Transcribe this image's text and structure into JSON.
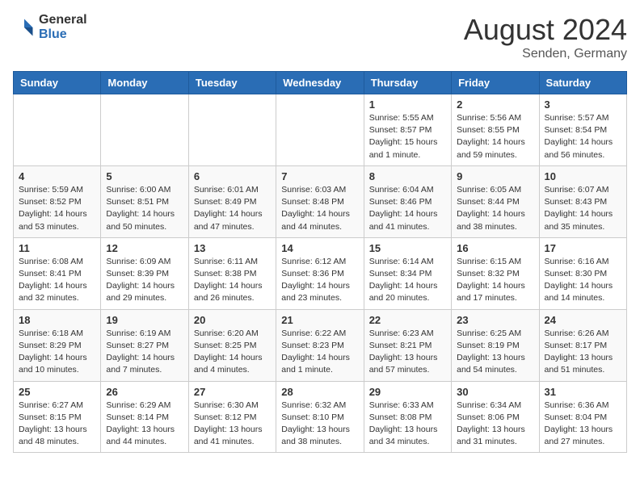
{
  "header": {
    "logo_general": "General",
    "logo_blue": "Blue",
    "month_year": "August 2024",
    "location": "Senden, Germany"
  },
  "calendar": {
    "days_of_week": [
      "Sunday",
      "Monday",
      "Tuesday",
      "Wednesday",
      "Thursday",
      "Friday",
      "Saturday"
    ],
    "weeks": [
      [
        {
          "day": "",
          "info": ""
        },
        {
          "day": "",
          "info": ""
        },
        {
          "day": "",
          "info": ""
        },
        {
          "day": "",
          "info": ""
        },
        {
          "day": "1",
          "info": "Sunrise: 5:55 AM\nSunset: 8:57 PM\nDaylight: 15 hours\nand 1 minute."
        },
        {
          "day": "2",
          "info": "Sunrise: 5:56 AM\nSunset: 8:55 PM\nDaylight: 14 hours\nand 59 minutes."
        },
        {
          "day": "3",
          "info": "Sunrise: 5:57 AM\nSunset: 8:54 PM\nDaylight: 14 hours\nand 56 minutes."
        }
      ],
      [
        {
          "day": "4",
          "info": "Sunrise: 5:59 AM\nSunset: 8:52 PM\nDaylight: 14 hours\nand 53 minutes."
        },
        {
          "day": "5",
          "info": "Sunrise: 6:00 AM\nSunset: 8:51 PM\nDaylight: 14 hours\nand 50 minutes."
        },
        {
          "day": "6",
          "info": "Sunrise: 6:01 AM\nSunset: 8:49 PM\nDaylight: 14 hours\nand 47 minutes."
        },
        {
          "day": "7",
          "info": "Sunrise: 6:03 AM\nSunset: 8:48 PM\nDaylight: 14 hours\nand 44 minutes."
        },
        {
          "day": "8",
          "info": "Sunrise: 6:04 AM\nSunset: 8:46 PM\nDaylight: 14 hours\nand 41 minutes."
        },
        {
          "day": "9",
          "info": "Sunrise: 6:05 AM\nSunset: 8:44 PM\nDaylight: 14 hours\nand 38 minutes."
        },
        {
          "day": "10",
          "info": "Sunrise: 6:07 AM\nSunset: 8:43 PM\nDaylight: 14 hours\nand 35 minutes."
        }
      ],
      [
        {
          "day": "11",
          "info": "Sunrise: 6:08 AM\nSunset: 8:41 PM\nDaylight: 14 hours\nand 32 minutes."
        },
        {
          "day": "12",
          "info": "Sunrise: 6:09 AM\nSunset: 8:39 PM\nDaylight: 14 hours\nand 29 minutes."
        },
        {
          "day": "13",
          "info": "Sunrise: 6:11 AM\nSunset: 8:38 PM\nDaylight: 14 hours\nand 26 minutes."
        },
        {
          "day": "14",
          "info": "Sunrise: 6:12 AM\nSunset: 8:36 PM\nDaylight: 14 hours\nand 23 minutes."
        },
        {
          "day": "15",
          "info": "Sunrise: 6:14 AM\nSunset: 8:34 PM\nDaylight: 14 hours\nand 20 minutes."
        },
        {
          "day": "16",
          "info": "Sunrise: 6:15 AM\nSunset: 8:32 PM\nDaylight: 14 hours\nand 17 minutes."
        },
        {
          "day": "17",
          "info": "Sunrise: 6:16 AM\nSunset: 8:30 PM\nDaylight: 14 hours\nand 14 minutes."
        }
      ],
      [
        {
          "day": "18",
          "info": "Sunrise: 6:18 AM\nSunset: 8:29 PM\nDaylight: 14 hours\nand 10 minutes."
        },
        {
          "day": "19",
          "info": "Sunrise: 6:19 AM\nSunset: 8:27 PM\nDaylight: 14 hours\nand 7 minutes."
        },
        {
          "day": "20",
          "info": "Sunrise: 6:20 AM\nSunset: 8:25 PM\nDaylight: 14 hours\nand 4 minutes."
        },
        {
          "day": "21",
          "info": "Sunrise: 6:22 AM\nSunset: 8:23 PM\nDaylight: 14 hours\nand 1 minute."
        },
        {
          "day": "22",
          "info": "Sunrise: 6:23 AM\nSunset: 8:21 PM\nDaylight: 13 hours\nand 57 minutes."
        },
        {
          "day": "23",
          "info": "Sunrise: 6:25 AM\nSunset: 8:19 PM\nDaylight: 13 hours\nand 54 minutes."
        },
        {
          "day": "24",
          "info": "Sunrise: 6:26 AM\nSunset: 8:17 PM\nDaylight: 13 hours\nand 51 minutes."
        }
      ],
      [
        {
          "day": "25",
          "info": "Sunrise: 6:27 AM\nSunset: 8:15 PM\nDaylight: 13 hours\nand 48 minutes."
        },
        {
          "day": "26",
          "info": "Sunrise: 6:29 AM\nSunset: 8:14 PM\nDaylight: 13 hours\nand 44 minutes."
        },
        {
          "day": "27",
          "info": "Sunrise: 6:30 AM\nSunset: 8:12 PM\nDaylight: 13 hours\nand 41 minutes."
        },
        {
          "day": "28",
          "info": "Sunrise: 6:32 AM\nSunset: 8:10 PM\nDaylight: 13 hours\nand 38 minutes."
        },
        {
          "day": "29",
          "info": "Sunrise: 6:33 AM\nSunset: 8:08 PM\nDaylight: 13 hours\nand 34 minutes."
        },
        {
          "day": "30",
          "info": "Sunrise: 6:34 AM\nSunset: 8:06 PM\nDaylight: 13 hours\nand 31 minutes."
        },
        {
          "day": "31",
          "info": "Sunrise: 6:36 AM\nSunset: 8:04 PM\nDaylight: 13 hours\nand 27 minutes."
        }
      ]
    ]
  }
}
